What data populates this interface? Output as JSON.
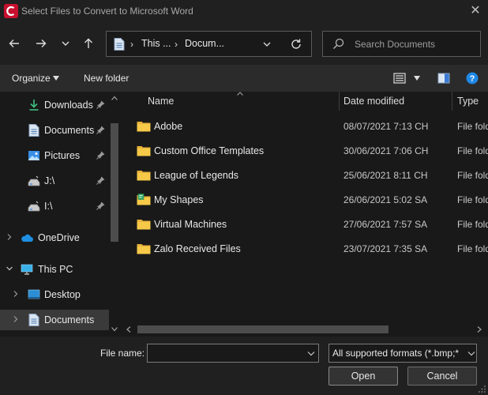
{
  "window": {
    "title": "Select Files to Convert to Microsoft Word",
    "accent": "#c8102e"
  },
  "address": {
    "segment1": "This ...",
    "segment2": "Docum..."
  },
  "search": {
    "placeholder": "Search Documents"
  },
  "toolbar": {
    "organize_label": "Organize",
    "new_folder_label": "New folder"
  },
  "sidebar": {
    "items": [
      {
        "label": "Downloads",
        "icon": "download-arrow-icon",
        "pinned": true
      },
      {
        "label": "Documents",
        "icon": "document-icon",
        "pinned": true
      },
      {
        "label": "Pictures",
        "icon": "pictures-icon",
        "pinned": true
      },
      {
        "label": "J:\\",
        "icon": "drive-icon",
        "pinned": true
      },
      {
        "label": "I:\\",
        "icon": "drive-icon",
        "pinned": true
      },
      {
        "label": "OneDrive",
        "icon": "cloud-icon",
        "pinned": false
      },
      {
        "label": "This PC",
        "icon": "computer-icon",
        "pinned": false
      },
      {
        "label": "Desktop",
        "icon": "desktop-icon",
        "pinned": false
      },
      {
        "label": "Documents",
        "icon": "document-icon",
        "pinned": false,
        "selected": true
      }
    ]
  },
  "columns": {
    "name": "Name",
    "date": "Date modified",
    "type": "Type"
  },
  "files": [
    {
      "name": "Adobe",
      "date": "08/07/2021 7:13 CH",
      "type": "File folder",
      "icon": "folder-icon"
    },
    {
      "name": "Custom Office Templates",
      "date": "30/06/2021 7:06 CH",
      "type": "File folder",
      "icon": "folder-icon"
    },
    {
      "name": "League of Legends",
      "date": "25/06/2021 8:11 CH",
      "type": "File folder",
      "icon": "folder-icon"
    },
    {
      "name": "My Shapes",
      "date": "26/06/2021 5:02 SA",
      "type": "File folder",
      "icon": "shapes-folder-icon"
    },
    {
      "name": "Virtual Machines",
      "date": "27/06/2021 7:57 SA",
      "type": "File folder",
      "icon": "folder-icon"
    },
    {
      "name": "Zalo Received Files",
      "date": "23/07/2021 7:35 SA",
      "type": "File folder",
      "icon": "folder-icon"
    }
  ],
  "bottom": {
    "file_name_label": "File name:",
    "file_name_value": "",
    "file_type_value": "All supported formats (*.bmp;*",
    "open_label": "Open",
    "cancel_label": "Cancel"
  }
}
